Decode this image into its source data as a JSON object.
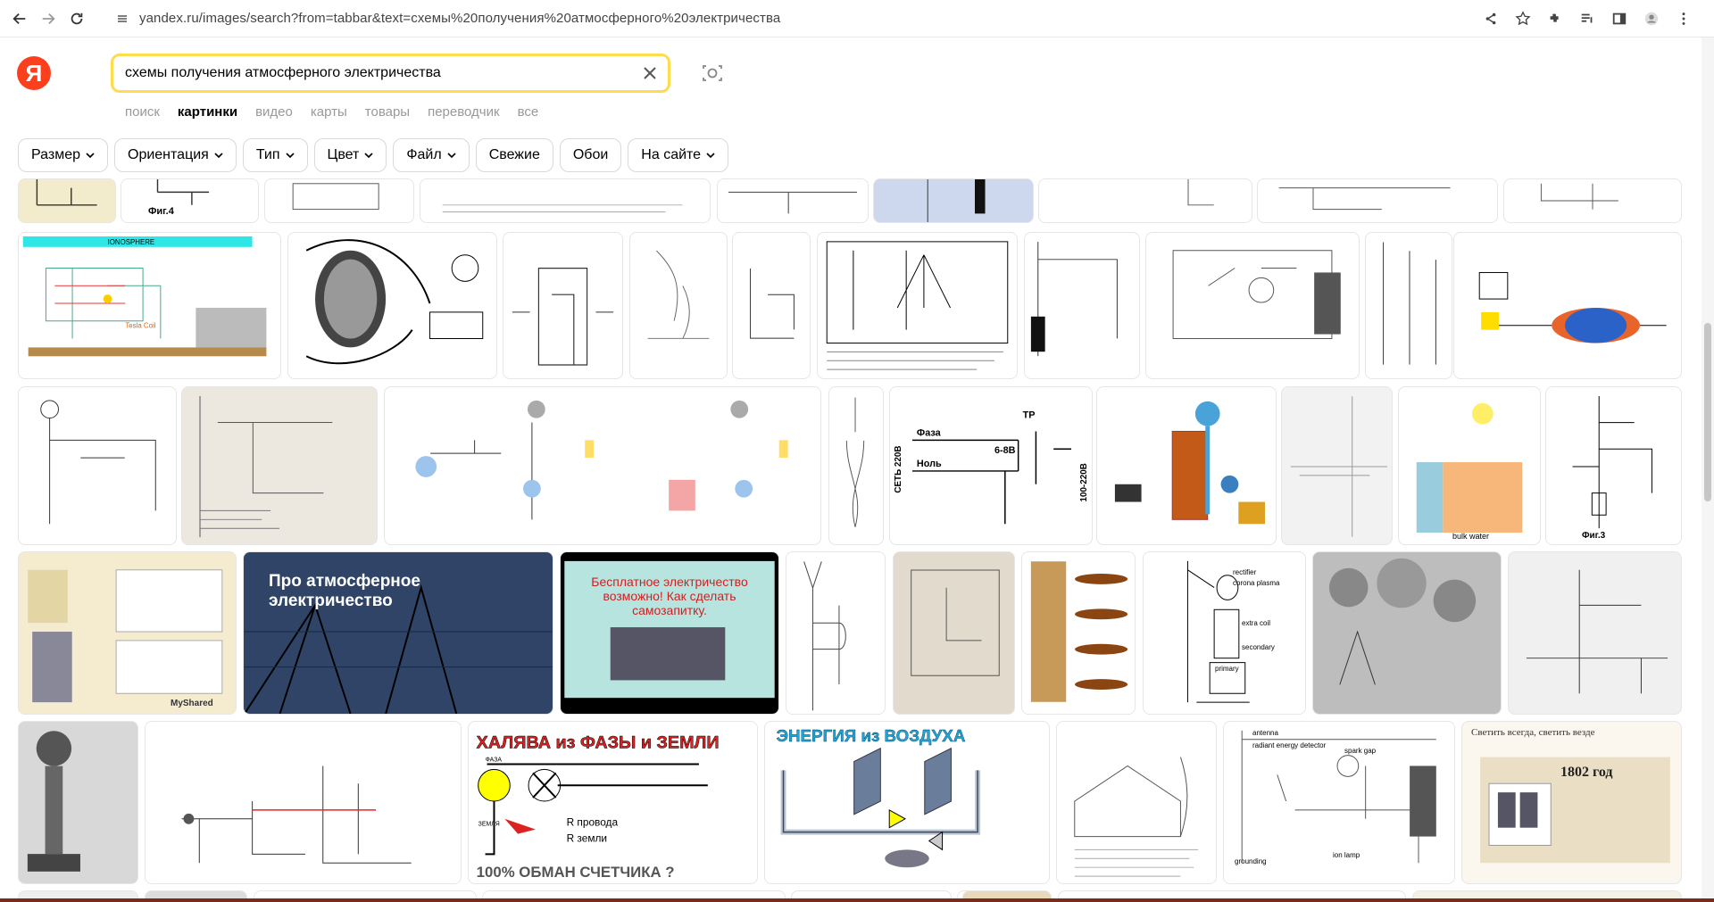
{
  "browser": {
    "url": "yandex.ru/images/search?from=tabbar&text=схемы%20получения%20атмосферного%20электричества"
  },
  "logo": "Я",
  "search": {
    "value": "схемы получения атмосферного электричества"
  },
  "tabs": [
    {
      "label": "поиск",
      "active": false
    },
    {
      "label": "картинки",
      "active": true
    },
    {
      "label": "видео",
      "active": false
    },
    {
      "label": "карты",
      "active": false
    },
    {
      "label": "товары",
      "active": false
    },
    {
      "label": "переводчик",
      "active": false
    },
    {
      "label": "все",
      "active": false
    }
  ],
  "filters": [
    {
      "label": "Размер",
      "dropdown": true
    },
    {
      "label": "Ориентация",
      "dropdown": true
    },
    {
      "label": "Тип",
      "dropdown": true
    },
    {
      "label": "Цвет",
      "dropdown": true
    },
    {
      "label": "Файл",
      "dropdown": true
    },
    {
      "label": "Свежие",
      "dropdown": false
    },
    {
      "label": "Обои",
      "dropdown": false
    },
    {
      "label": "На сайте",
      "dropdown": true
    }
  ],
  "thumb_texts": {
    "fig4": "Фиг.4",
    "ionosphere": "IONOSPHERE",
    "tesla_coil": "Tesla Coil",
    "faza": "Фаза",
    "nol": "Ноль",
    "tr": "ТР",
    "v68": "6-8В",
    "set220": "СЕТЬ 220В",
    "v100": "100-220В",
    "fig3": "Фиг.3",
    "bulk_water": "bulk water",
    "pro_atmo": "Про атмосферное электричество",
    "besplatnoe": "Бесплатное электричество возможно! Как сделать самозапитку.",
    "halyava": "ХАЛЯВА из ФАЗЫ и ЗЕМЛИ",
    "obman": "100% ОБМАН СЧЕТЧИКА ?",
    "energiya": "ЭНЕРГИЯ из ВОЗДУХА",
    "svetit": "Светить всегда, светить везде",
    "year1802": "1802 год",
    "antenna": "antenna",
    "radiant": "radiant energy detector",
    "spark_gap": "spark gap",
    "grounding": "grounding",
    "ion_lamp": "ion lamp",
    "rectifier": "rectifier",
    "corona": "corona plasma",
    "extra_coil": "extra coil",
    "secondary": "secondary",
    "primary": "primary",
    "r_provoda": "R провода",
    "r_zemli": "R земли",
    "faza_small": "ФАЗА",
    "zemlya": "ЗЕМЛЯ",
    "myshared": "MyShared"
  }
}
